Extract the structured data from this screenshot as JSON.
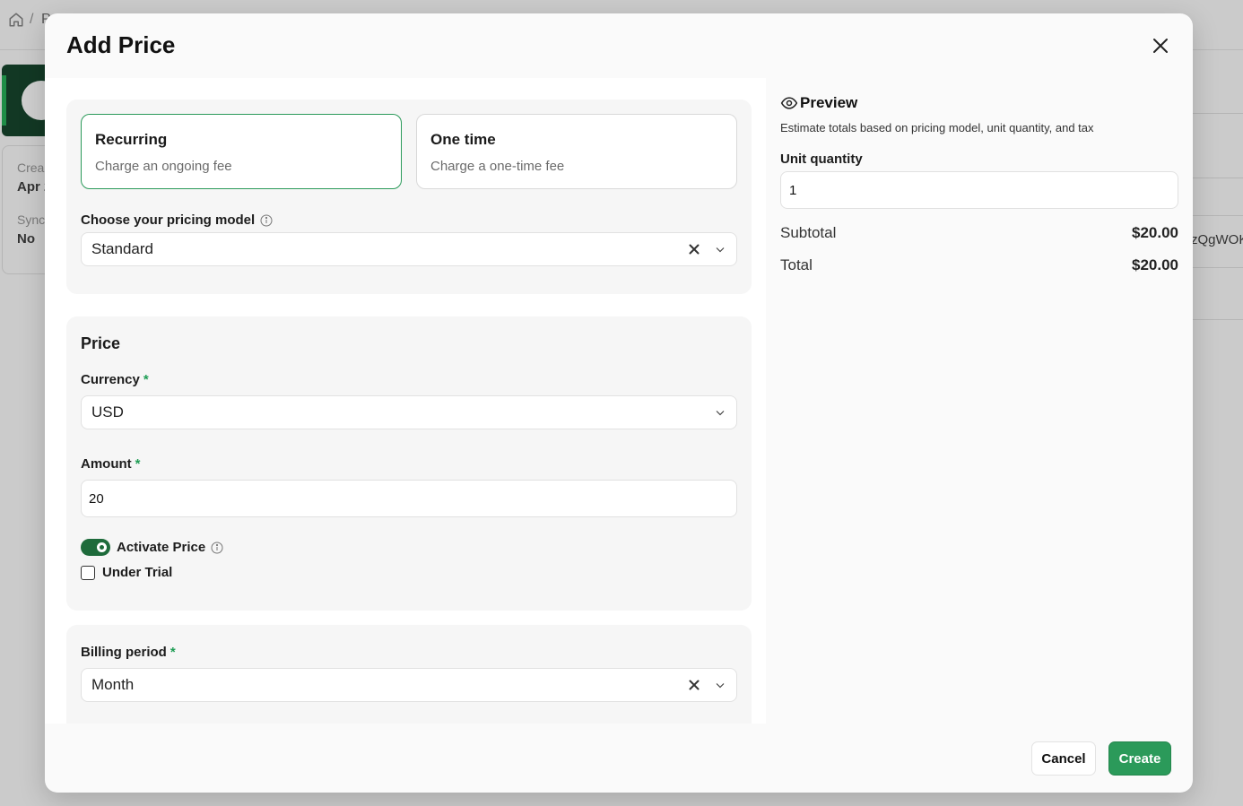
{
  "background": {
    "breadcrumb_separator": "/",
    "breadcrumb_partial": "P",
    "info_created_label": "Crea",
    "info_created_value": "Apr 2",
    "info_sync_label": "Sync",
    "info_sync_value": "No",
    "right_partial_text": "zQgWOK"
  },
  "modal": {
    "title": "Add Price",
    "close_icon": "close-icon",
    "type_options": [
      {
        "title": "Recurring",
        "subtitle": "Charge an ongoing fee",
        "selected": true
      },
      {
        "title": "One time",
        "subtitle": "Charge a one-time fee",
        "selected": false
      }
    ],
    "pricing_model": {
      "label": "Choose your pricing model",
      "value": "Standard"
    },
    "price_section": {
      "title": "Price",
      "currency": {
        "label": "Currency",
        "required_mark": "*",
        "value": "USD"
      },
      "amount": {
        "label": "Amount",
        "required_mark": "*",
        "value": "20"
      },
      "activate_price": {
        "label": "Activate Price",
        "on": true
      },
      "under_trial": {
        "label": "Under Trial",
        "checked": false
      }
    },
    "billing": {
      "label": "Billing period",
      "required_mark": "*",
      "value": "Month"
    },
    "preview": {
      "title": "Preview",
      "subtitle": "Estimate totals based on pricing model, unit quantity, and tax",
      "unit_quantity_label": "Unit quantity",
      "unit_quantity_value": "1",
      "subtotal_label": "Subtotal",
      "subtotal_value": "$20.00",
      "total_label": "Total",
      "total_value": "$20.00"
    },
    "footer": {
      "cancel_label": "Cancel",
      "create_label": "Create"
    },
    "colors": {
      "accent": "#2b9a5a",
      "toggle_on": "#1e6b3b",
      "required": "#1f9d55"
    }
  }
}
